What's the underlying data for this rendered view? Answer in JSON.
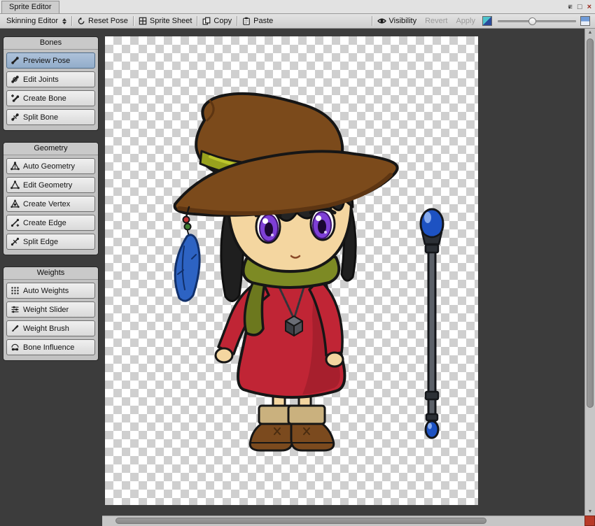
{
  "window": {
    "title": "Sprite Editor",
    "controls": {
      "caret": "▾",
      "menu": "≡",
      "maximize": "□",
      "close": "×"
    }
  },
  "toolbar": {
    "mode_dropdown": {
      "label": "Skinning Editor"
    },
    "reset_pose": {
      "label": "Reset Pose"
    },
    "sprite_sheet": {
      "label": "Sprite Sheet"
    },
    "copy": {
      "label": "Copy"
    },
    "paste": {
      "label": "Paste"
    },
    "visibility": {
      "label": "Visibility"
    },
    "revert": {
      "label": "Revert",
      "enabled": false
    },
    "apply": {
      "label": "Apply",
      "enabled": false
    }
  },
  "sidebar": {
    "panels": [
      {
        "title": "Bones",
        "items": [
          {
            "label": "Preview Pose",
            "icon": "preview-pose-icon",
            "selected": true
          },
          {
            "label": "Edit Joints",
            "icon": "edit-joints-icon",
            "selected": false
          },
          {
            "label": "Create Bone",
            "icon": "create-bone-icon",
            "selected": false
          },
          {
            "label": "Split Bone",
            "icon": "split-bone-icon",
            "selected": false
          }
        ]
      },
      {
        "title": "Geometry",
        "items": [
          {
            "label": "Auto Geometry",
            "icon": "auto-geometry-icon",
            "selected": false
          },
          {
            "label": "Edit Geometry",
            "icon": "edit-geometry-icon",
            "selected": false
          },
          {
            "label": "Create Vertex",
            "icon": "create-vertex-icon",
            "selected": false
          },
          {
            "label": "Create Edge",
            "icon": "create-edge-icon",
            "selected": false
          },
          {
            "label": "Split Edge",
            "icon": "split-edge-icon",
            "selected": false
          }
        ]
      },
      {
        "title": "Weights",
        "items": [
          {
            "label": "Auto Weights",
            "icon": "auto-weights-icon",
            "selected": false
          },
          {
            "label": "Weight Slider",
            "icon": "weight-slider-icon",
            "selected": false
          },
          {
            "label": "Weight Brush",
            "icon": "weight-brush-icon",
            "selected": false
          },
          {
            "label": "Bone Influence",
            "icon": "bone-influence-icon",
            "selected": false
          }
        ]
      }
    ]
  },
  "scrollbars": {
    "up": "▲",
    "down": "▼"
  },
  "colors": {
    "selected_tool_bg": "#92adca",
    "viewport_bg": "#3c3c3c",
    "checker_light": "#ffffff",
    "checker_dark": "#cfcfcf",
    "resize_grip": "#b83a28"
  }
}
